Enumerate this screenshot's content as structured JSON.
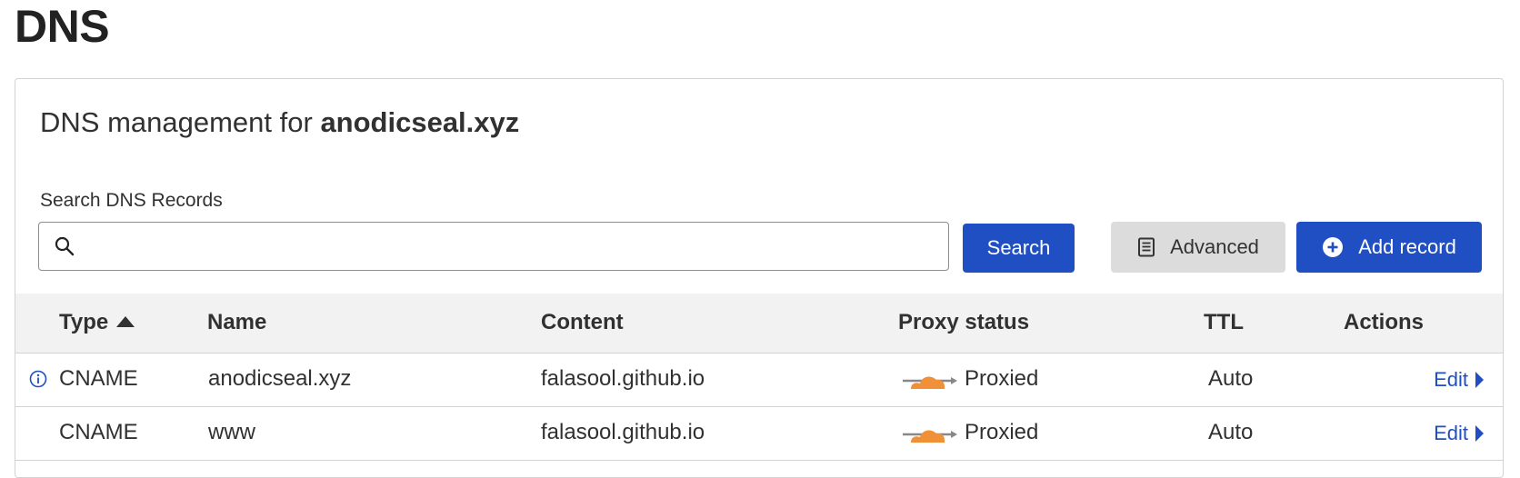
{
  "page": {
    "title": "DNS"
  },
  "card": {
    "heading_prefix": "DNS management for",
    "domain": "anodicseal.xyz"
  },
  "search": {
    "label": "Search DNS Records",
    "value": "",
    "placeholder": "",
    "button_label": "Search"
  },
  "toolbar": {
    "advanced_label": "Advanced",
    "add_record_label": "Add record"
  },
  "table": {
    "columns": [
      "Type",
      "Name",
      "Content",
      "Proxy status",
      "TTL",
      "Actions"
    ],
    "sort_column": "Type",
    "sort_direction": "ascending",
    "rows": [
      {
        "type": "CNAME",
        "name": "anodicseal.xyz",
        "content": "falasool.github.io",
        "proxy": "Proxied",
        "ttl": "Auto",
        "action": "Edit",
        "info": true
      },
      {
        "type": "CNAME",
        "name": "www",
        "content": "falasool.github.io",
        "proxy": "Proxied",
        "ttl": "Auto",
        "action": "Edit",
        "info": false
      }
    ]
  },
  "colors": {
    "primary": "#1f4fc2",
    "cloud": "#f38020",
    "header_bg": "#f2f2f2",
    "secondary_button": "#dcdcdc"
  },
  "icons": {
    "search": "search-icon",
    "advanced": "document-icon",
    "add": "plus-circle-icon",
    "sort": "sort-ascending-icon",
    "info": "info-icon",
    "proxied": "cloud-icon",
    "edit": "caret-right-icon"
  }
}
